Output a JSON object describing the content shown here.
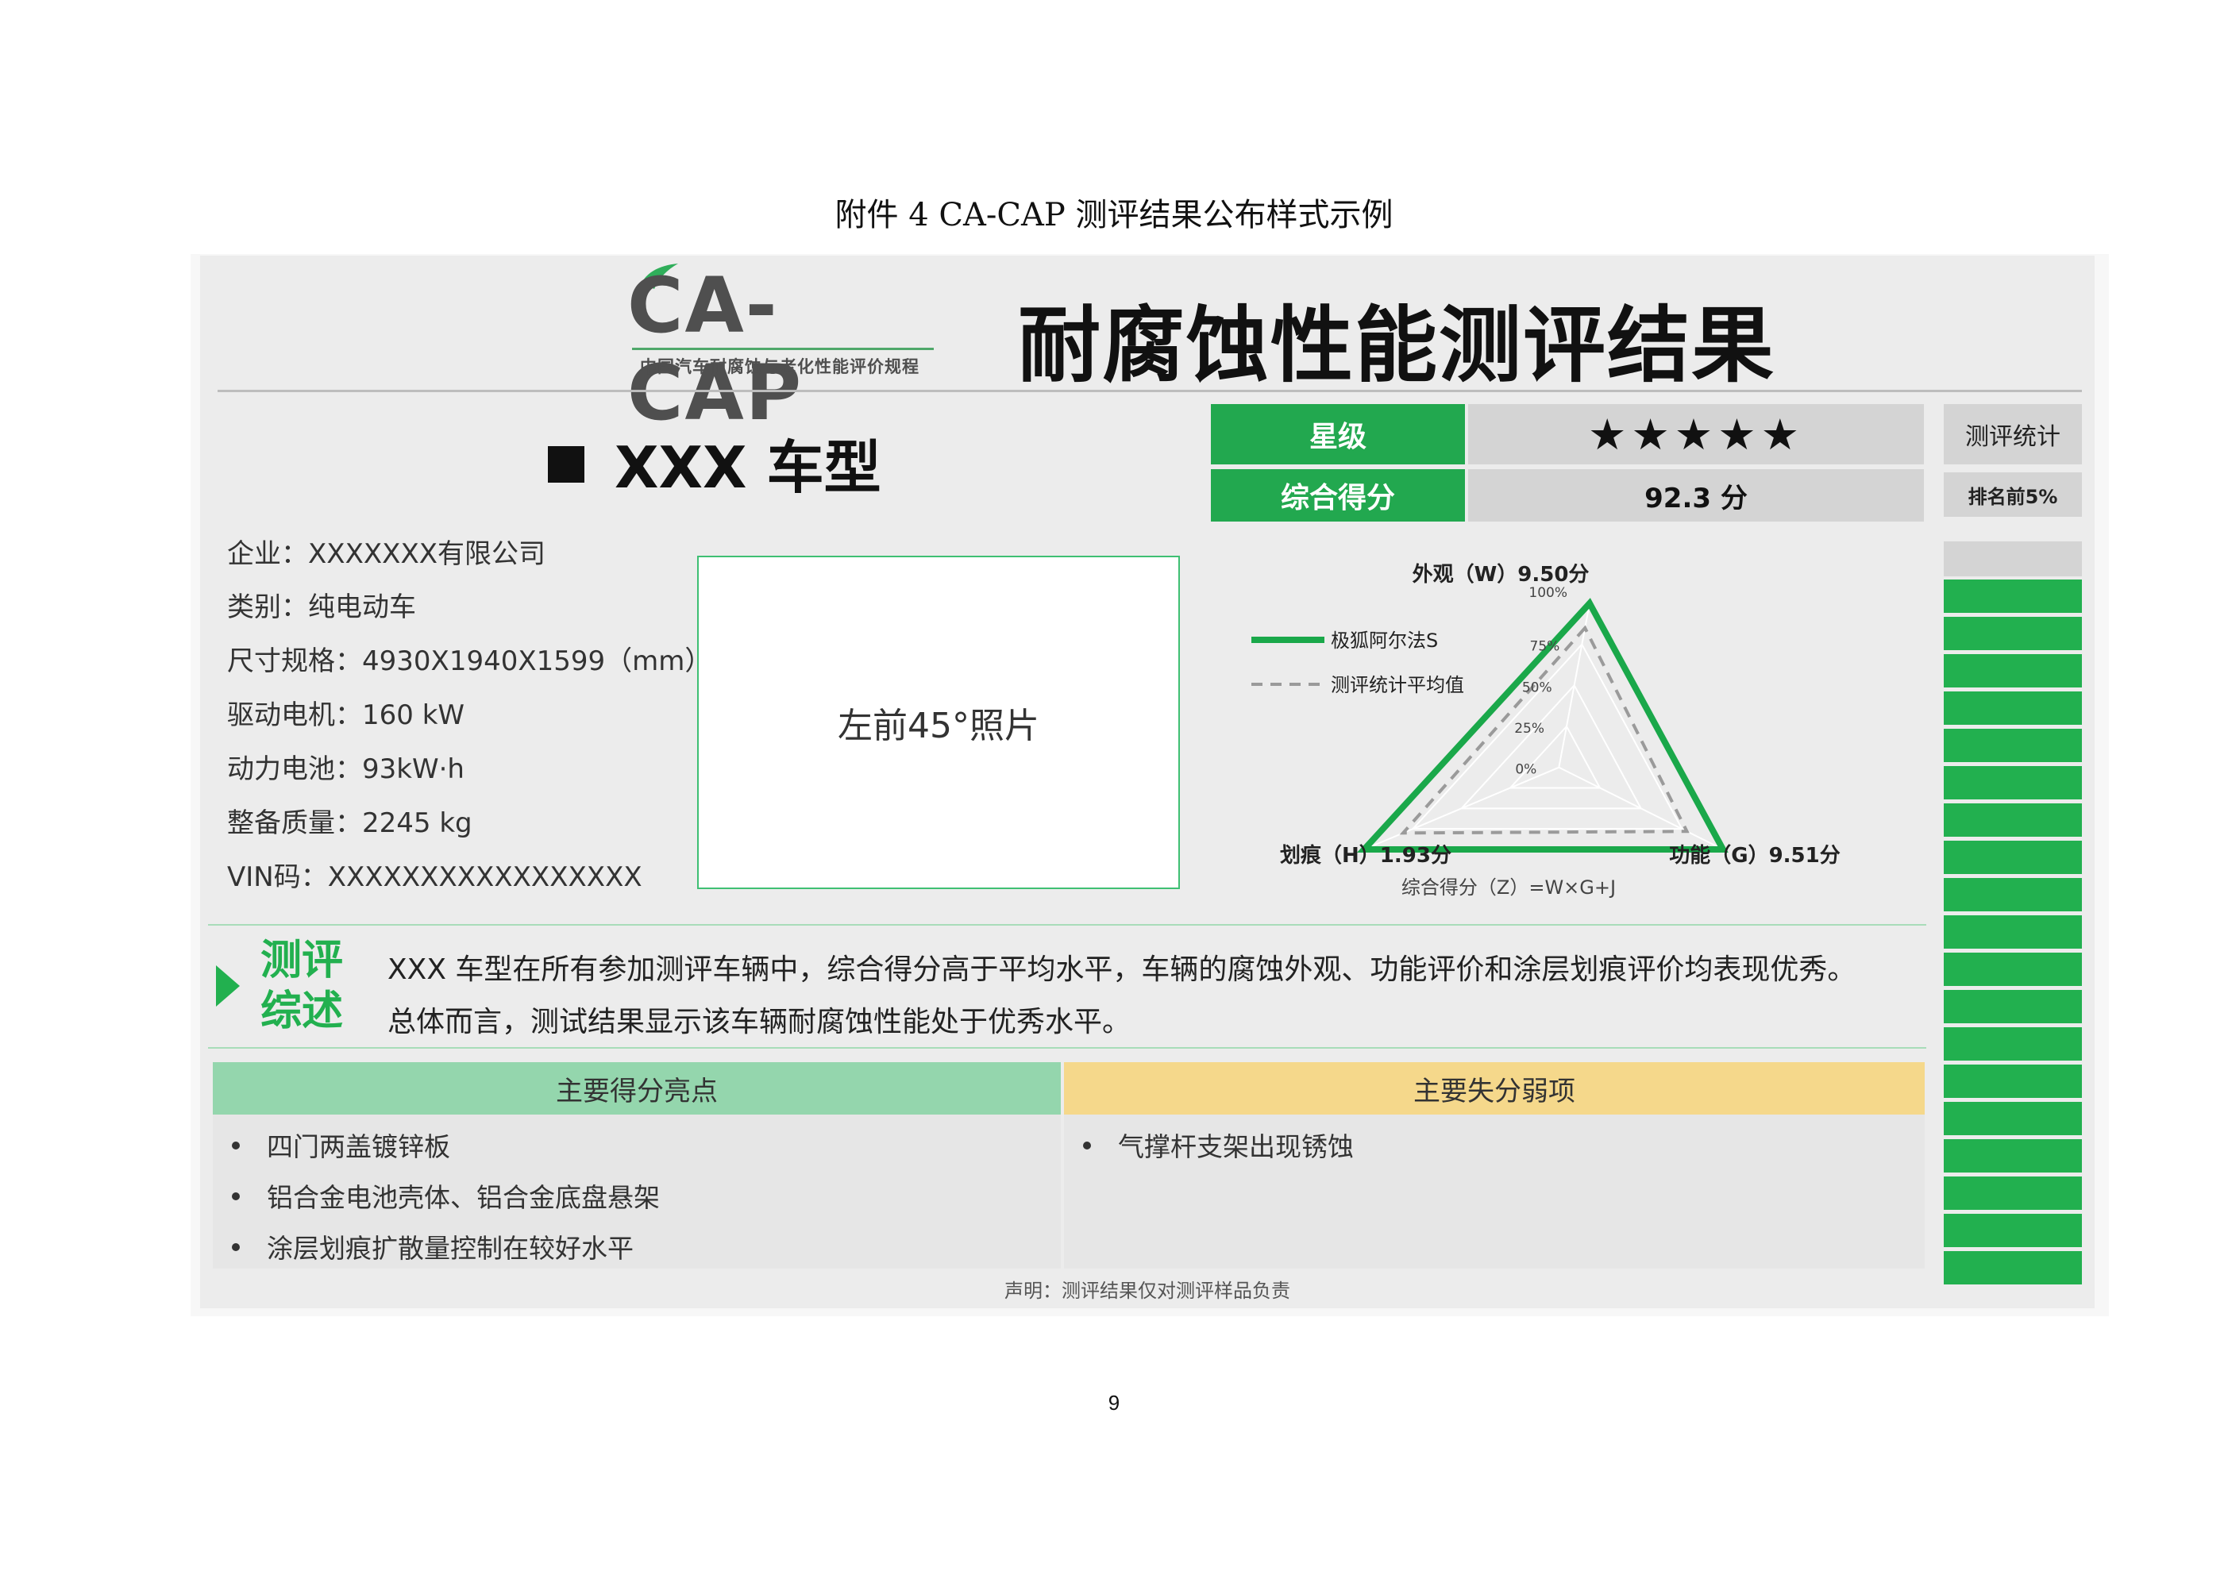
{
  "doc_title": "附件 4   CA-CAP 测评结果公布样式示例",
  "header": {
    "logo_text": "CA-CAP",
    "logo_subtitle": "中国汽车耐腐蚀与老化性能评价规程",
    "title": "耐腐蚀性能测评结果"
  },
  "model": {
    "name": "XXX 车型",
    "specs": [
      "企业：XXXXXXX有限公司",
      "类别：纯电动车",
      "尺寸规格：4930X1940X1599（mm）",
      "驱动电机：160 kW",
      "动力电池：93kW·h",
      "整备质量：2245 kg",
      "VIN码：XXXXXXXXXXXXXXXXX"
    ],
    "photo_label": "左前45°照片"
  },
  "scores": {
    "star_label": "星级",
    "star_value": "★★★★★",
    "total_label": "综合得分",
    "total_value": "92.3 分",
    "stat_label": "测评统计",
    "rank_label": "排名前5%"
  },
  "ranking": {
    "top_fraction": 0.05,
    "segments": 19
  },
  "radar": {
    "label_w": "外观（W）9.50分",
    "label_h": "划痕（H）1.93分",
    "label_g": "功能（G）9.51分",
    "ticks": [
      "100%",
      "75%",
      "50%",
      "25%",
      "0%"
    ],
    "formula": "综合得分（Z）=W×G+J",
    "legend": [
      "极狐阿尔法S",
      "测评统计平均值"
    ],
    "colors": {
      "vehicle": "#1aa84a",
      "average": "#9a9a9a"
    },
    "vehicle_values": [
      1.0,
      1.0,
      1.0
    ],
    "average_values": [
      0.85,
      0.8,
      0.78
    ]
  },
  "summary": {
    "label": "测评综述",
    "lines": [
      "XXX 车型在所有参加测评车辆中，综合得分高于平均水平，车辆的腐蚀外观、功能评价和涂层划痕评价均表现优秀。",
      "总体而言，测试结果显示该车辆耐腐蚀性能处于优秀水平。"
    ]
  },
  "highlights": {
    "title": "主要得分亮点",
    "items": [
      "四门两盖镀锌板",
      "铝合金电池壳体、铝合金底盘悬架",
      "涂层划痕扩散量控制在较好水平"
    ]
  },
  "weaknesses": {
    "title": "主要失分弱项",
    "items": [
      "气撑杆支架出现锈蚀"
    ]
  },
  "disclaimer": "声明：测评结果仅对测评样品负责",
  "page_number": "9"
}
